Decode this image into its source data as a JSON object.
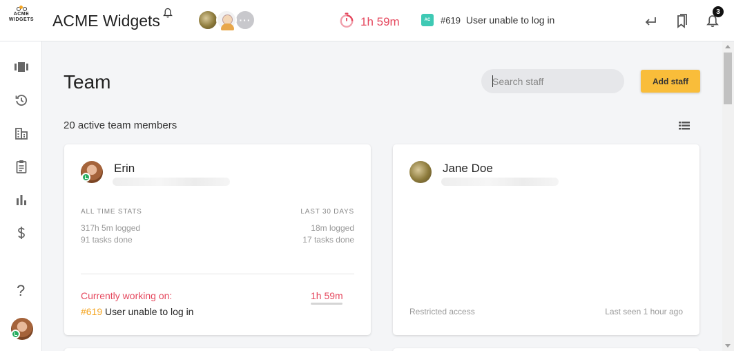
{
  "header": {
    "logo_line1": "ACME",
    "logo_line2": "WIDGETS",
    "app_title": "ACME Widgets",
    "avatars": [
      "user-avatar-1",
      "user-avatar-2",
      "more-avatars"
    ],
    "more_label": "···",
    "timer": "1h 59m",
    "task_badge": "AC",
    "task_number": "#619",
    "task_title": "User unable to log in",
    "notification_count": "3"
  },
  "sidebar": {
    "items": [
      "board-icon",
      "history-icon",
      "building-icon",
      "clipboard-icon",
      "bar-chart-icon",
      "dollar-icon"
    ],
    "help": "?"
  },
  "main": {
    "page_title": "Team",
    "search_placeholder": "Search staff",
    "add_staff_label": "Add staff",
    "members_count": "20 active team members"
  },
  "cards": [
    {
      "name": "Erin",
      "all_time_label": "ALL TIME STATS",
      "last_30_label": "LAST 30 DAYS",
      "all_time_logged": "317h 5m logged",
      "all_time_tasks": "91 tasks done",
      "last30_logged": "18m logged",
      "last30_tasks": "17 tasks done",
      "working_label": "Currently working on:",
      "working_time": "1h 59m",
      "working_task_num": "#619",
      "working_task_title": "User unable to log in"
    },
    {
      "name": "Jane Doe",
      "access": "Restricted access",
      "last_seen": "Last seen 1 hour ago"
    }
  ],
  "colors": {
    "accent_red": "#e5485e",
    "accent_yellow": "#f9bd3a",
    "online_green": "#27ae60",
    "badge_teal": "#3ec9b4"
  }
}
